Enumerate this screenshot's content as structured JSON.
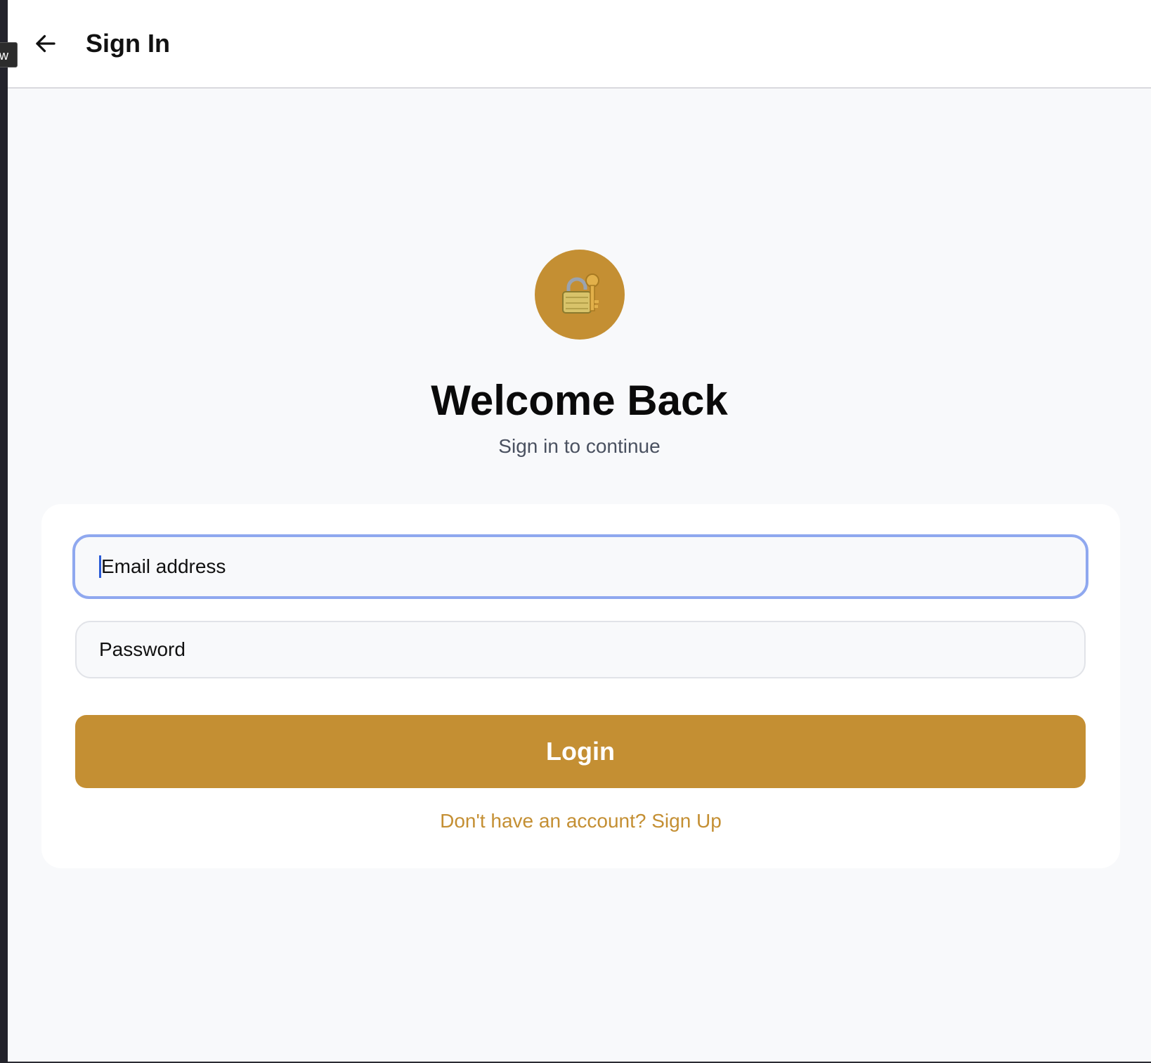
{
  "header": {
    "title": "Sign In",
    "back_icon": "arrow-left-icon"
  },
  "overlay": {
    "tooltip_text": "w"
  },
  "hero": {
    "icon": "lock-with-key-icon",
    "icon_glyph": "🔐",
    "title": "Welcome Back",
    "subtitle": "Sign in to continue"
  },
  "form": {
    "email_placeholder": "Email address",
    "password_placeholder": "Password",
    "login_label": "Login",
    "signup_text": "Don't have an account? Sign Up"
  },
  "colors": {
    "accent": "#c48f33",
    "focus_ring": "#8fa8ef",
    "background": "#f8f9fb"
  }
}
